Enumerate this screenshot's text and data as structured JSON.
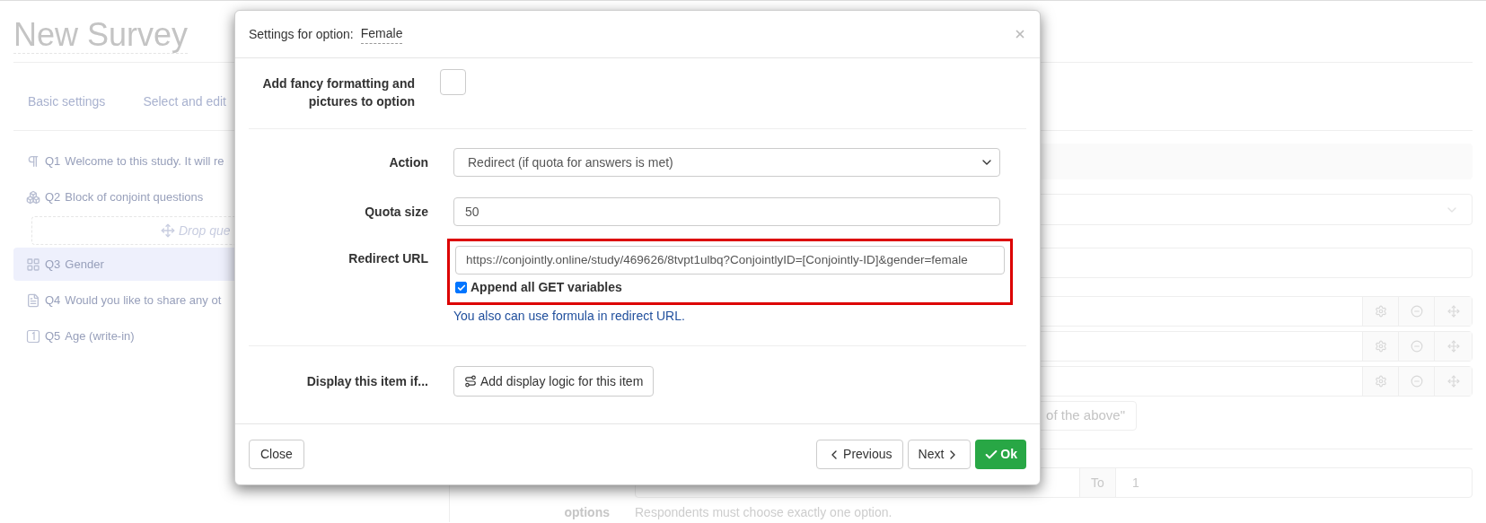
{
  "page": {
    "title": "New Survey",
    "tabs": [
      "Basic settings",
      "Select and edit"
    ]
  },
  "questions": [
    {
      "kind": "paragraph",
      "number": "Q1",
      "text": "Welcome to this study. It will re",
      "selected": false
    },
    {
      "kind": "block",
      "number": "Q2",
      "text": "Block of conjoint questions",
      "selected": false,
      "drop_hint": "Drop que"
    },
    {
      "kind": "choice",
      "number": "Q3",
      "text": "Gender",
      "selected": true
    },
    {
      "kind": "text",
      "number": "Q4",
      "text": "Would you like to share any ot",
      "selected": false
    },
    {
      "kind": "number",
      "number": "Q5",
      "text": "Age (write-in)",
      "selected": false
    }
  ],
  "editor": {
    "option_rows": [
      {
        "kind": "option"
      },
      {
        "kind": "option"
      },
      {
        "kind": "option"
      }
    ],
    "none_button": "of the above\"",
    "force": {
      "label": "options",
      "to_label": "To",
      "to_value": "1",
      "help": "Respondents must choose exactly one option."
    }
  },
  "modal": {
    "title": "Settings for option:",
    "option_name": "Female",
    "fancy": {
      "label": "Add fancy formatting and pictures to option",
      "checked": false
    },
    "action": {
      "label": "Action",
      "value": "Redirect (if quota for answers is met)"
    },
    "quota": {
      "label": "Quota size",
      "value": "50"
    },
    "redirect": {
      "label": "Redirect URL",
      "value": "https://conjointly.online/study/469626/8tvpt1ulbq?ConjointlyID=[Conjointly-ID]&gender=female",
      "append_label": "Append all GET variables",
      "append_checked": true,
      "highlighted": true,
      "help": "You also can use formula in redirect URL."
    },
    "display": {
      "label": "Display this item if...",
      "button": "Add display logic for this item"
    },
    "footer": {
      "close": "Close",
      "previous": "Previous",
      "next": "Next",
      "ok": "Ok"
    }
  }
}
